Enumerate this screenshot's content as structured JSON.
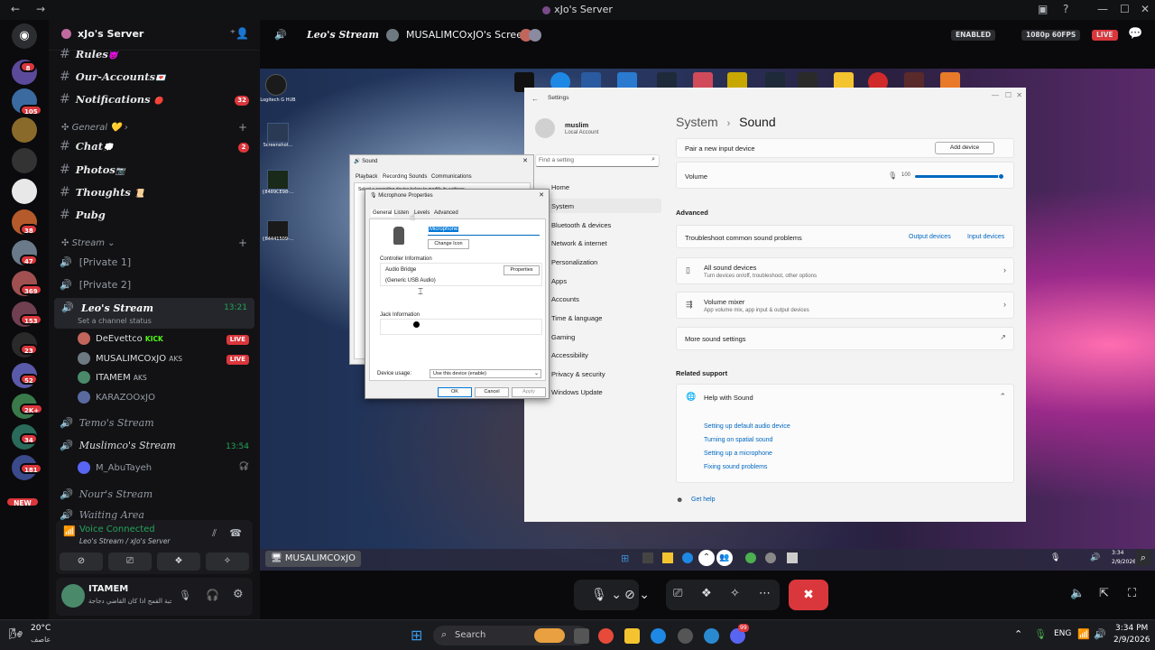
{
  "window": {
    "title": "xJo's Server"
  },
  "rail": {
    "badges": [
      "8",
      "105",
      "38",
      "47",
      "369",
      "153",
      "23",
      "52",
      "2K+",
      "34",
      "181"
    ],
    "new_label": "NEW"
  },
  "server": {
    "name": "xJo's Server",
    "channels": [
      {
        "name": "Rules",
        "emoji": "😈"
      },
      {
        "name": "Our-Accounts",
        "emoji": "💌"
      },
      {
        "name": "Notifications",
        "emoji": "🔴",
        "count": "32"
      }
    ],
    "category_general": "General",
    "general_channels": [
      {
        "name": "Chat",
        "emoji": "💭",
        "count": "2"
      },
      {
        "name": "Photos",
        "emoji": "📷"
      },
      {
        "name": "Thoughts",
        "emoji": "📜"
      },
      {
        "name": "Pubg",
        "emoji": ""
      }
    ],
    "category_stream": "Stream",
    "voice_channels": [
      {
        "name": "[Private 1]"
      },
      {
        "name": "[Private 2]"
      }
    ],
    "active_channel": {
      "name": "Leo's Stream",
      "time": "13:21",
      "status": "Set a channel status"
    },
    "members": [
      {
        "name": "DeEvettco",
        "tag": "KICK",
        "live": "LIVE",
        "color": "#c2655a"
      },
      {
        "name": "MUSALIMCOxJO",
        "tag": "AKS",
        "live": "LIVE",
        "color": "#6d7a82"
      },
      {
        "name": "ITAMEM",
        "tag": "AKS",
        "live": "",
        "color": "#4a8a6a"
      },
      {
        "name": "KARAZOOxJO",
        "tag": "",
        "live": "",
        "color": "#5a6aa0"
      }
    ],
    "other_channels": [
      {
        "name": "Temo's Stream",
        "time": ""
      },
      {
        "name": "Muslimco's Stream",
        "time": "13:54"
      }
    ],
    "muslimco_member": "M_AbuTayeh",
    "more_channels": [
      "Nour's Stream",
      "Waiting Area"
    ]
  },
  "voice": {
    "status": "Voice Connected",
    "location": "Leo's Stream / xJo's Server"
  },
  "user": {
    "name": "ITAMEM",
    "status": "يشكي حبة القمح اذا كان القاضي دجاجة"
  },
  "stream_header": {
    "channel": "Leo's Stream",
    "screen": "MUSALIMCOxJO's Screen",
    "enabled": "ENABLED",
    "quality": "1080p 60FPS",
    "live": "LIVE"
  },
  "desktop": {
    "icons": [
      "Logitech G HUB",
      "Screenshot...",
      "{8489CE98-...",
      "{84441509-..."
    ]
  },
  "settings": {
    "window_title": "Settings",
    "user_name": "muslim",
    "user_sub": "Local Account",
    "search_placeholder": "Find a setting",
    "breadcrumb_parent": "System",
    "breadcrumb_current": "Sound",
    "nav": [
      "Home",
      "System",
      "Bluetooth & devices",
      "Network & internet",
      "Personalization",
      "Apps",
      "Accounts",
      "Time & language",
      "Gaming",
      "Accessibility",
      "Privacy & security",
      "Windows Update"
    ],
    "pair_label": "Pair a new input device",
    "add_device": "Add device",
    "volume_label": "Volume",
    "volume_value": "100",
    "volume_level": 1.0,
    "advanced_heading": "Advanced",
    "troubleshoot": "Troubleshoot common sound problems",
    "output_devices": "Output devices",
    "input_devices": "Input devices",
    "all_devices_title": "All sound devices",
    "all_devices_sub": "Turn devices on/off, troubleshoot, other options",
    "mixer_title": "Volume mixer",
    "mixer_sub": "App volume mix, app input & output devices",
    "more_settings": "More sound settings",
    "related_heading": "Related support",
    "help_title": "Help with Sound",
    "help_links": [
      "Setting up default audio device",
      "Turning on spatial sound",
      "Setting up a microphone",
      "Fixing sound problems"
    ],
    "get_help": "Get help"
  },
  "sound_dialog": {
    "title": "Sound",
    "tabs": [
      "Playback",
      "Recording",
      "Sounds",
      "Communications"
    ],
    "hint": "Select a recording device below to modify its settings:"
  },
  "mic_dialog": {
    "title": "Microphone Properties",
    "tabs": [
      "General",
      "Listen",
      "Levels",
      "Advanced"
    ],
    "name_value": "Microphone",
    "change_icon": "Change Icon",
    "controller_heading": "Controller Information",
    "controller_name": "Audio Bridge",
    "controller_driver": "(Generic USB Audio)",
    "properties_btn": "Properties",
    "jack_heading": "Jack Information",
    "device_usage_label": "Device usage:",
    "device_usage_value": "Use this device (enable)",
    "ok": "OK",
    "cancel": "Cancel",
    "apply": "Apply"
  },
  "remote_taskbar": {
    "user": "MUSALIMCOxJO",
    "time": "3:34",
    "date": "2/9/2026"
  },
  "host_taskbar": {
    "weather_temp": "20°C",
    "weather_desc": "عاصف",
    "search": "Search",
    "lang": "ENG",
    "time": "3:34 PM",
    "date": "2/9/2026",
    "discord_badge": "99"
  }
}
